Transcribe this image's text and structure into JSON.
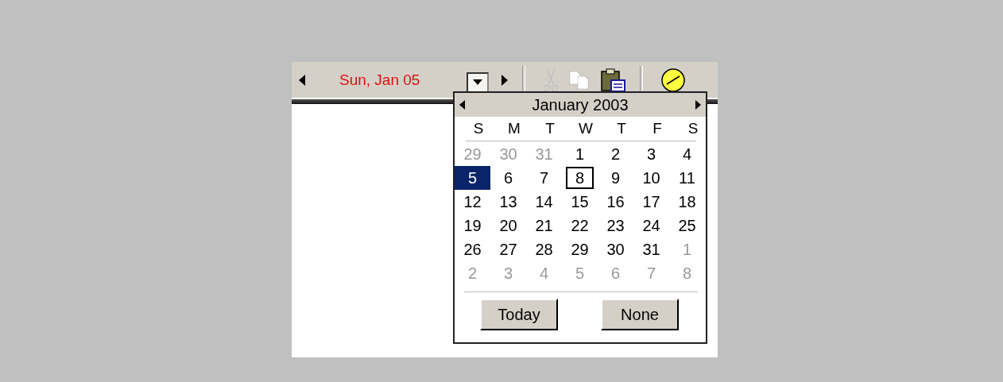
{
  "toolbar": {
    "date_text": "Sun, Jan 05",
    "dropdown_pressed": true,
    "tools": [
      {
        "kind": "cut",
        "disabled": true
      },
      {
        "kind": "copy",
        "disabled": true
      },
      {
        "kind": "paste",
        "disabled": false
      },
      {
        "kind": "clock",
        "disabled": false
      }
    ]
  },
  "calendar": {
    "title": "January 2003",
    "weekdays": [
      "S",
      "M",
      "T",
      "W",
      "T",
      "F",
      "S"
    ],
    "weeks": [
      [
        {
          "day": "29",
          "other_month": true,
          "selected": false,
          "today": false
        },
        {
          "day": "30",
          "other_month": true,
          "selected": false,
          "today": false
        },
        {
          "day": "31",
          "other_month": true,
          "selected": false,
          "today": false
        },
        {
          "day": "1",
          "other_month": false,
          "selected": false,
          "today": false
        },
        {
          "day": "2",
          "other_month": false,
          "selected": false,
          "today": false
        },
        {
          "day": "3",
          "other_month": false,
          "selected": false,
          "today": false
        },
        {
          "day": "4",
          "other_month": false,
          "selected": false,
          "today": false
        }
      ],
      [
        {
          "day": "5",
          "other_month": false,
          "selected": true,
          "today": false
        },
        {
          "day": "6",
          "other_month": false,
          "selected": false,
          "today": false
        },
        {
          "day": "7",
          "other_month": false,
          "selected": false,
          "today": false
        },
        {
          "day": "8",
          "other_month": false,
          "selected": false,
          "today": true
        },
        {
          "day": "9",
          "other_month": false,
          "selected": false,
          "today": false
        },
        {
          "day": "10",
          "other_month": false,
          "selected": false,
          "today": false
        },
        {
          "day": "11",
          "other_month": false,
          "selected": false,
          "today": false
        }
      ],
      [
        {
          "day": "12",
          "other_month": false,
          "selected": false,
          "today": false
        },
        {
          "day": "13",
          "other_month": false,
          "selected": false,
          "today": false
        },
        {
          "day": "14",
          "other_month": false,
          "selected": false,
          "today": false
        },
        {
          "day": "15",
          "other_month": false,
          "selected": false,
          "today": false
        },
        {
          "day": "16",
          "other_month": false,
          "selected": false,
          "today": false
        },
        {
          "day": "17",
          "other_month": false,
          "selected": false,
          "today": false
        },
        {
          "day": "18",
          "other_month": false,
          "selected": false,
          "today": false
        }
      ],
      [
        {
          "day": "19",
          "other_month": false,
          "selected": false,
          "today": false
        },
        {
          "day": "20",
          "other_month": false,
          "selected": false,
          "today": false
        },
        {
          "day": "21",
          "other_month": false,
          "selected": false,
          "today": false
        },
        {
          "day": "22",
          "other_month": false,
          "selected": false,
          "today": false
        },
        {
          "day": "23",
          "other_month": false,
          "selected": false,
          "today": false
        },
        {
          "day": "24",
          "other_month": false,
          "selected": false,
          "today": false
        },
        {
          "day": "25",
          "other_month": false,
          "selected": false,
          "today": false
        }
      ],
      [
        {
          "day": "26",
          "other_month": false,
          "selected": false,
          "today": false
        },
        {
          "day": "27",
          "other_month": false,
          "selected": false,
          "today": false
        },
        {
          "day": "28",
          "other_month": false,
          "selected": false,
          "today": false
        },
        {
          "day": "29",
          "other_month": false,
          "selected": false,
          "today": false
        },
        {
          "day": "30",
          "other_month": false,
          "selected": false,
          "today": false
        },
        {
          "day": "31",
          "other_month": false,
          "selected": false,
          "today": false
        },
        {
          "day": "1",
          "other_month": true,
          "selected": false,
          "today": false
        }
      ],
      [
        {
          "day": "2",
          "other_month": true,
          "selected": false,
          "today": false
        },
        {
          "day": "3",
          "other_month": true,
          "selected": false,
          "today": false
        },
        {
          "day": "4",
          "other_month": true,
          "selected": false,
          "today": false
        },
        {
          "day": "5",
          "other_month": true,
          "selected": false,
          "today": false
        },
        {
          "day": "6",
          "other_month": true,
          "selected": false,
          "today": false
        },
        {
          "day": "7",
          "other_month": true,
          "selected": false,
          "today": false
        },
        {
          "day": "8",
          "other_month": true,
          "selected": false,
          "today": false
        }
      ]
    ],
    "buttons": [
      "Today",
      "None"
    ]
  }
}
